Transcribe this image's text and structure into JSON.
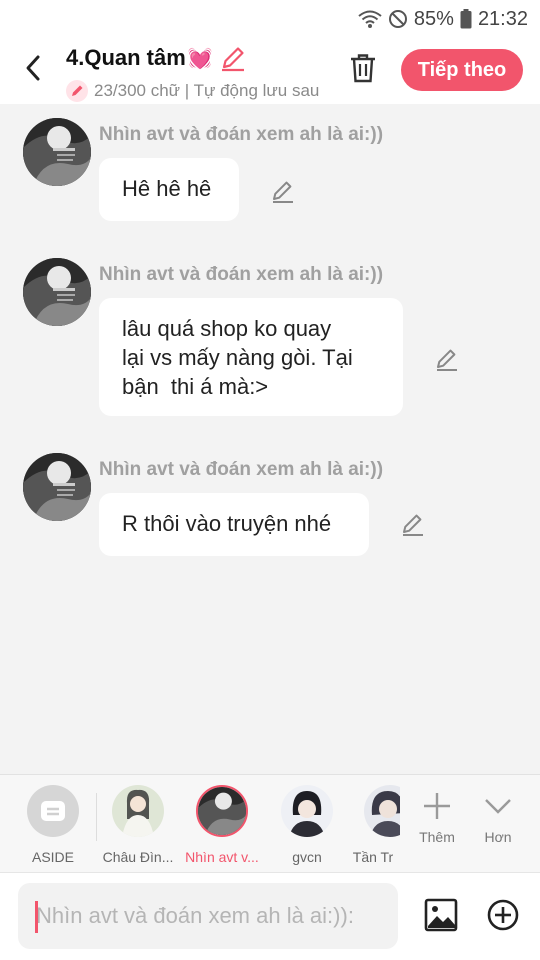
{
  "status_bar": {
    "battery": "85%",
    "time": "21:32"
  },
  "header": {
    "title": "4.Quan tâm",
    "title_emoji": "💓",
    "subtitle": "23/300 chữ | Tự động lưu sau",
    "next_label": "Tiếp theo"
  },
  "messages": [
    {
      "sender": "Nhìn avt và đoán xem ah là ai:))",
      "text": "Hê hê hê"
    },
    {
      "sender": "Nhìn avt và đoán xem ah là ai:))",
      "lines": [
        "lâu quá shop ko quay",
        "lại vs mấy nàng gòi. Tại",
        "bận  thi á mà:>"
      ]
    },
    {
      "sender": "Nhìn avt và đoán xem ah là ai:))",
      "text": "R thôi vào truyện nhé"
    }
  ],
  "characters": [
    {
      "name": "ASIDE"
    },
    {
      "name": "Châu Đìn..."
    },
    {
      "name": "Nhìn avt v..."
    },
    {
      "name": "gvcn"
    },
    {
      "name": "Tần Tr"
    }
  ],
  "tools": {
    "add_label": "Thêm",
    "more_label": "Hơn"
  },
  "input": {
    "placeholder": "Nhìn avt và đoán xem ah là ai:)):"
  },
  "colors": {
    "accent": "#f2556c"
  }
}
